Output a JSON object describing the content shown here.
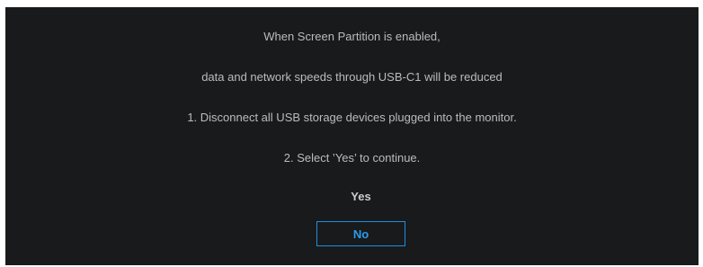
{
  "dialog": {
    "lines": [
      "When Screen Partition is enabled,",
      "data and network speeds through USB-C1 will be reduced",
      "1. Disconnect all USB storage devices plugged into the monitor.",
      "2. Select ’Yes’ to continue."
    ],
    "options": {
      "yes_label": "Yes",
      "no_label": "No",
      "selected": "No"
    }
  },
  "colors": {
    "background": "#191a1c",
    "text": "#b9bcc0",
    "accent": "#1e8fe0"
  }
}
